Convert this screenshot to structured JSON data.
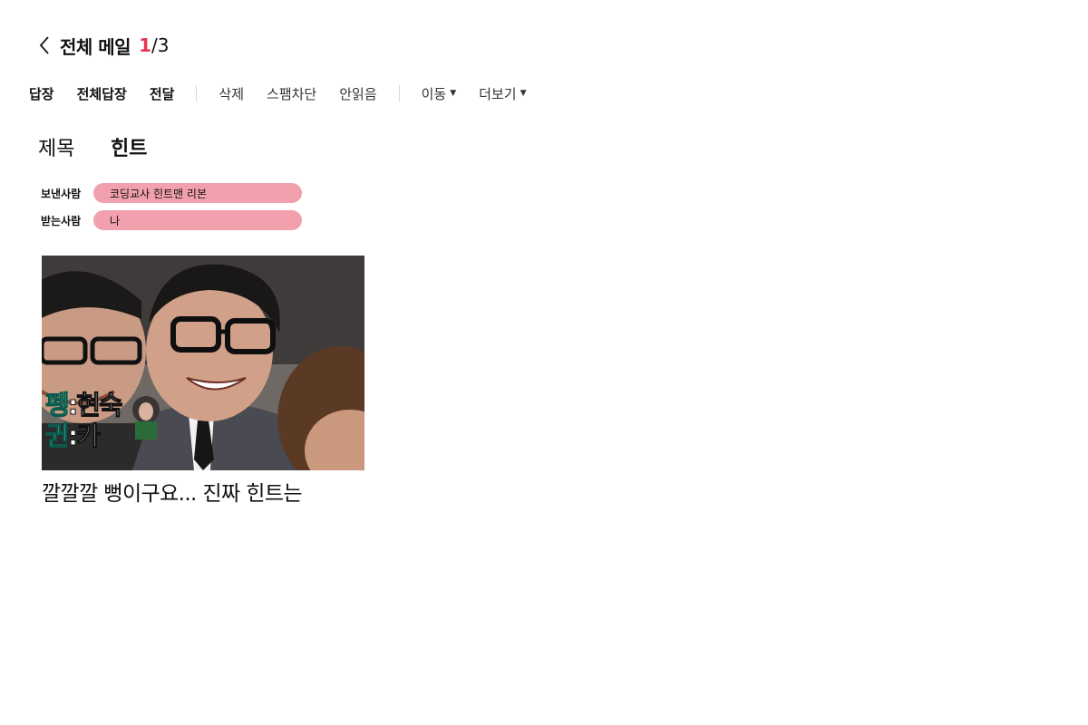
{
  "header": {
    "title": "전체 메일",
    "page_current": "1",
    "page_separator": "/",
    "page_total": "3"
  },
  "toolbar": {
    "reply": "답장",
    "reply_all": "전체답장",
    "forward": "전달",
    "delete": "삭제",
    "block_spam": "스팸차단",
    "unread": "안읽음",
    "move": "이동",
    "more": "더보기"
  },
  "mail": {
    "subject_label": "제목",
    "subject": "힌트",
    "sender_label": "보낸사람",
    "sender": "코딩교사 힌트맨 리본",
    "receiver_label": "받는사람",
    "receiver": "나",
    "image_overlay": {
      "line1_left": "펭",
      "line1_right": ":현숙",
      "line2_left": "귄",
      "line2_right": ":카"
    },
    "body_text": "깔깔깔 뻥이구요... 진짜 힌트는"
  },
  "colors": {
    "accent": "#e5374f",
    "pill": "#f2a0ad",
    "overlay_green": "#33e6c8"
  }
}
